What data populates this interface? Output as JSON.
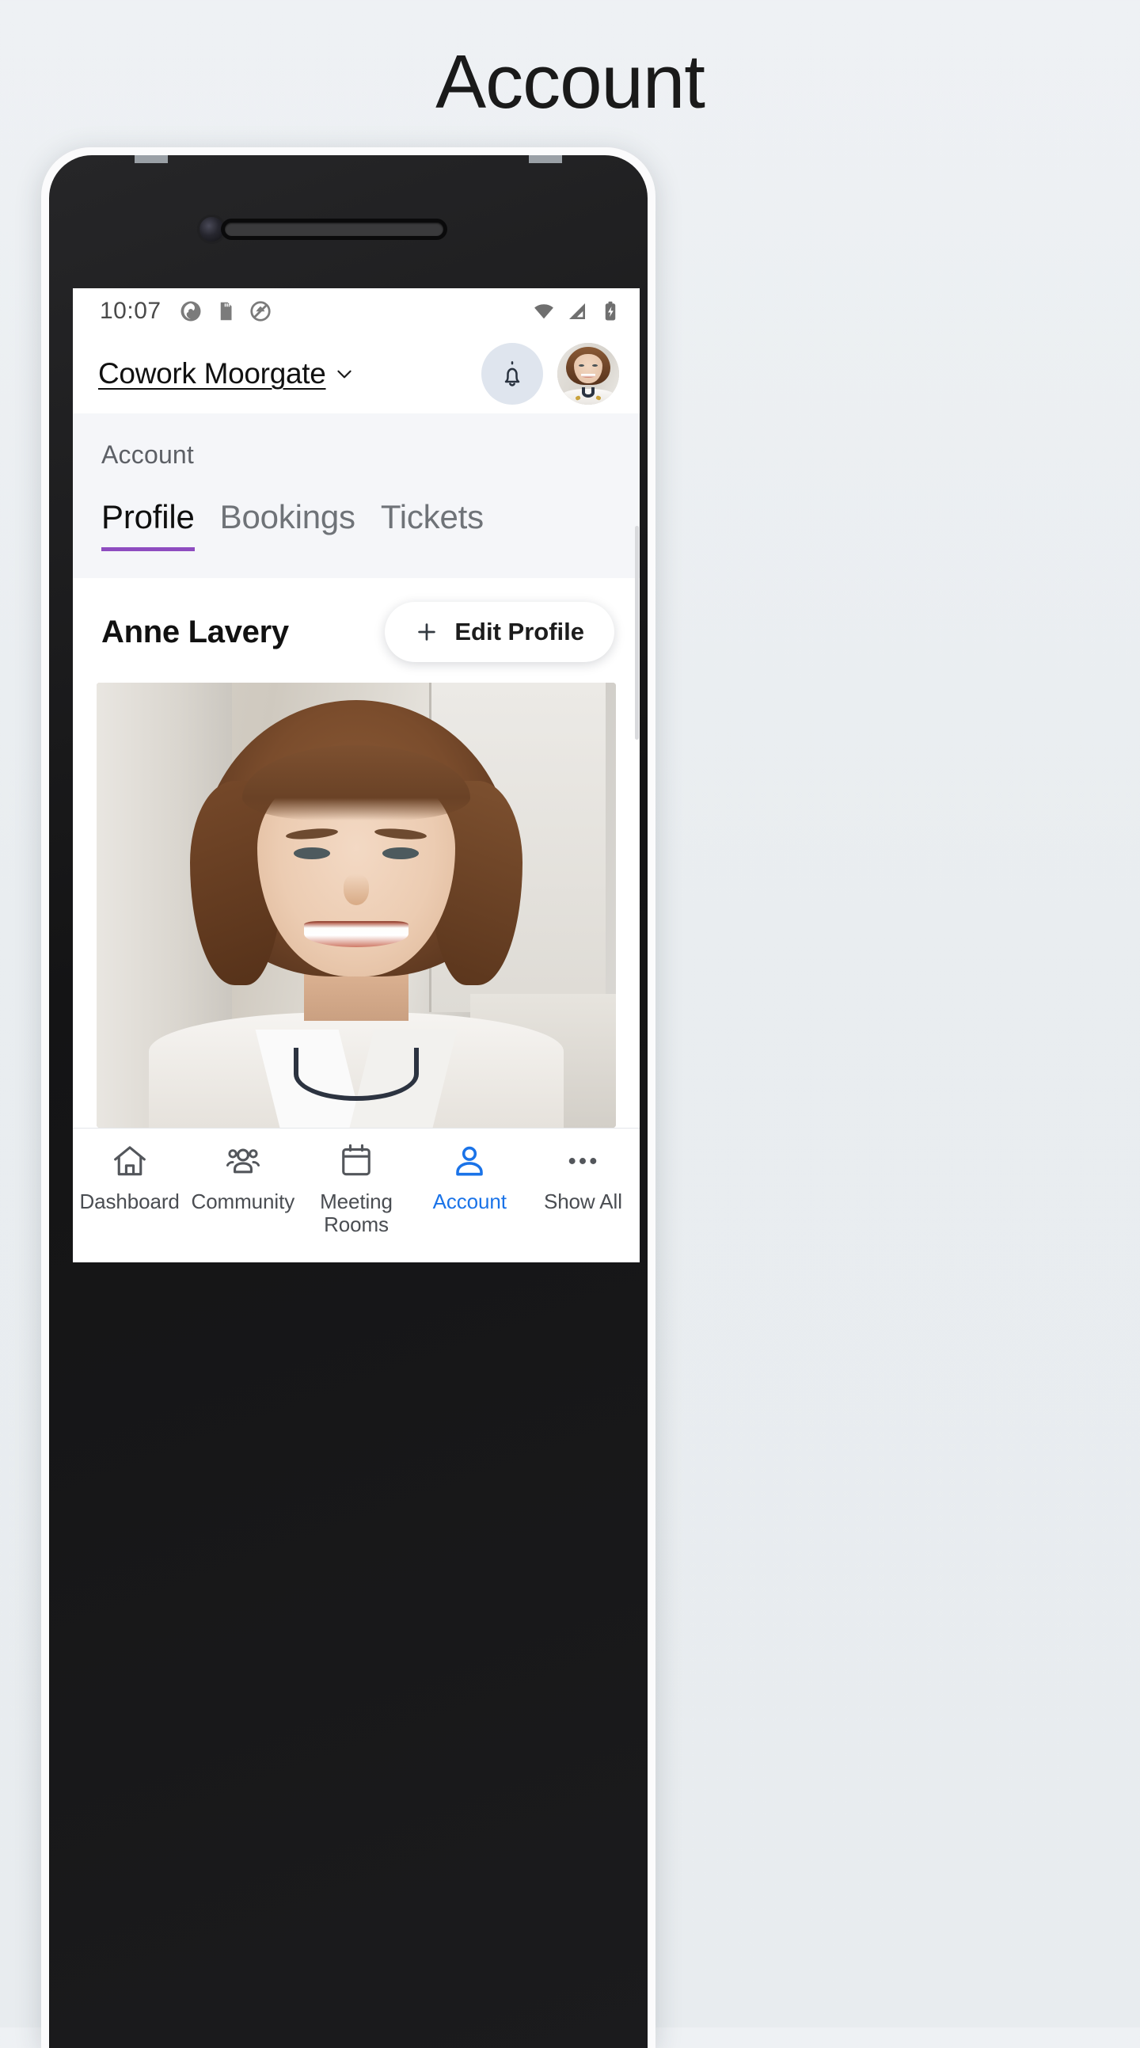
{
  "page": {
    "title": "Account"
  },
  "device": {
    "camera_icon": "front-camera",
    "speaker_icon": "earpiece-speaker"
  },
  "statusbar": {
    "time": "10:07",
    "left_icons": [
      "app-sync-icon",
      "sd-card-icon",
      "do-not-disturb-icon"
    ],
    "right_icons": [
      "wifi-icon",
      "cellular-signal-icon",
      "battery-charging-icon"
    ]
  },
  "appbar": {
    "venue_name": "Cowork Moorgate",
    "venue_chevron": "chevron-down-icon",
    "notifications_icon": "bell-icon",
    "avatar_icon": "user-avatar",
    "bell_bg_color": "#dfe5ee"
  },
  "section": {
    "label": "Account",
    "tabs": [
      {
        "label": "Profile",
        "active": true
      },
      {
        "label": "Bookings",
        "active": false
      },
      {
        "label": "Tickets",
        "active": false
      }
    ],
    "active_tab_color": "#8e4cc0"
  },
  "profile": {
    "name": "Anne Lavery",
    "edit_button": {
      "label": "Edit Profile",
      "icon": "plus-icon"
    },
    "photo_alt": "profile-photo"
  },
  "bottomnav": {
    "items": [
      {
        "label": "Dashboard",
        "icon": "home-icon",
        "active": false
      },
      {
        "label": "Community",
        "icon": "people-icon",
        "active": false
      },
      {
        "label": "Meeting Rooms",
        "icon": "calendar-icon",
        "active": false
      },
      {
        "label": "Account",
        "icon": "person-icon",
        "active": true
      },
      {
        "label": "Show All",
        "icon": "ellipsis-icon",
        "active": false
      }
    ],
    "active_color": "#1a73e8"
  }
}
